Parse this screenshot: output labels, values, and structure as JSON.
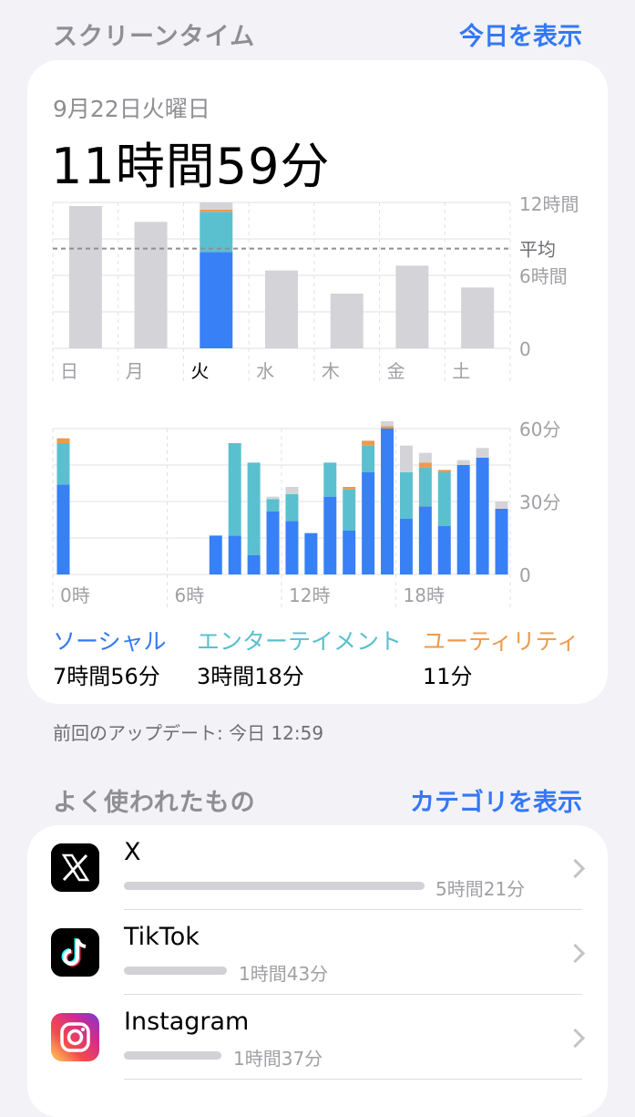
{
  "header": {
    "title": "スクリーンタイム",
    "link": "今日を表示"
  },
  "summary": {
    "date": "9月22日火曜日",
    "total": "11時間59分"
  },
  "chart_data": [
    {
      "type": "bar",
      "categories": [
        "日",
        "月",
        "火",
        "水",
        "木",
        "金",
        "土"
      ],
      "selected": "火",
      "values": [
        11.7,
        10.4,
        12.0,
        6.4,
        4.5,
        6.8,
        5.0
      ],
      "series": [
        {
          "name": "ソーシャル",
          "values": [
            null,
            null,
            7.93,
            null,
            null,
            null,
            null
          ]
        },
        {
          "name": "エンターテイメント",
          "values": [
            null,
            null,
            3.3,
            null,
            null,
            null,
            null
          ]
        },
        {
          "name": "ユーティリティ",
          "values": [
            null,
            null,
            0.18,
            null,
            null,
            null,
            null
          ]
        }
      ],
      "average": 8.2,
      "ylim": [
        0,
        12
      ],
      "y_ticks": [
        "12時間",
        "6時間",
        "0"
      ],
      "average_label": "平均",
      "colors": {
        "social": "#3880f6",
        "entertainment": "#5ac0cf",
        "utility": "#ec9a4c",
        "other": "#d4d4d8",
        "inactive": "#d4d4d8"
      }
    },
    {
      "type": "bar",
      "stacked": true,
      "x": [
        0,
        1,
        2,
        3,
        4,
        5,
        6,
        7,
        8,
        9,
        10,
        11,
        12,
        13,
        14,
        15,
        16,
        17,
        18,
        19,
        20,
        21,
        22,
        23
      ],
      "social": [
        37,
        0,
        0,
        0,
        0,
        0,
        0,
        0,
        16,
        16,
        8,
        26,
        22,
        17,
        32,
        18,
        42,
        60,
        23,
        28,
        20,
        45,
        48,
        27
      ],
      "entertainment": [
        17,
        0,
        0,
        0,
        0,
        0,
        0,
        0,
        0,
        38,
        38,
        5,
        11,
        0,
        14,
        17,
        11,
        0,
        19,
        16,
        22,
        0,
        0,
        0
      ],
      "utility": [
        2,
        0,
        0,
        0,
        0,
        0,
        0,
        0,
        0,
        0,
        0,
        0,
        0,
        0,
        0,
        1,
        2,
        1,
        0,
        2,
        1,
        0,
        0,
        0
      ],
      "other": [
        0,
        0,
        0,
        0,
        0,
        0,
        0,
        0,
        0,
        0,
        0,
        1,
        3,
        0,
        0,
        0,
        0,
        2,
        11,
        4,
        0,
        2,
        4,
        3
      ],
      "ylim": [
        0,
        60
      ],
      "y_ticks": [
        "60分",
        "30分",
        "0"
      ],
      "x_ticks": [
        "0時",
        "6時",
        "12時",
        "18時"
      ]
    }
  ],
  "categories": [
    {
      "name": "ソーシャル",
      "value": "7時間56分",
      "color": "#3478f6"
    },
    {
      "name": "エンターテイメント",
      "value": "3時間18分",
      "color": "#5ac0cf"
    },
    {
      "name": "ユーティリティ",
      "value": "11分",
      "color": "#ec9a4c"
    }
  ],
  "updated": "前回のアップデート: 今日 12:59",
  "most_used": {
    "title": "よく使われたもの",
    "link": "カテゴリを表示"
  },
  "apps": [
    {
      "name": "X",
      "time": "5時間21分",
      "usage": 0.445,
      "icon": "x-logo-icon"
    },
    {
      "name": "TikTok",
      "time": "1時間43分",
      "usage": 0.143,
      "icon": "tiktok-logo-icon"
    },
    {
      "name": "Instagram",
      "time": "1時間37分",
      "usage": 0.135,
      "icon": "instagram-logo-icon"
    }
  ]
}
